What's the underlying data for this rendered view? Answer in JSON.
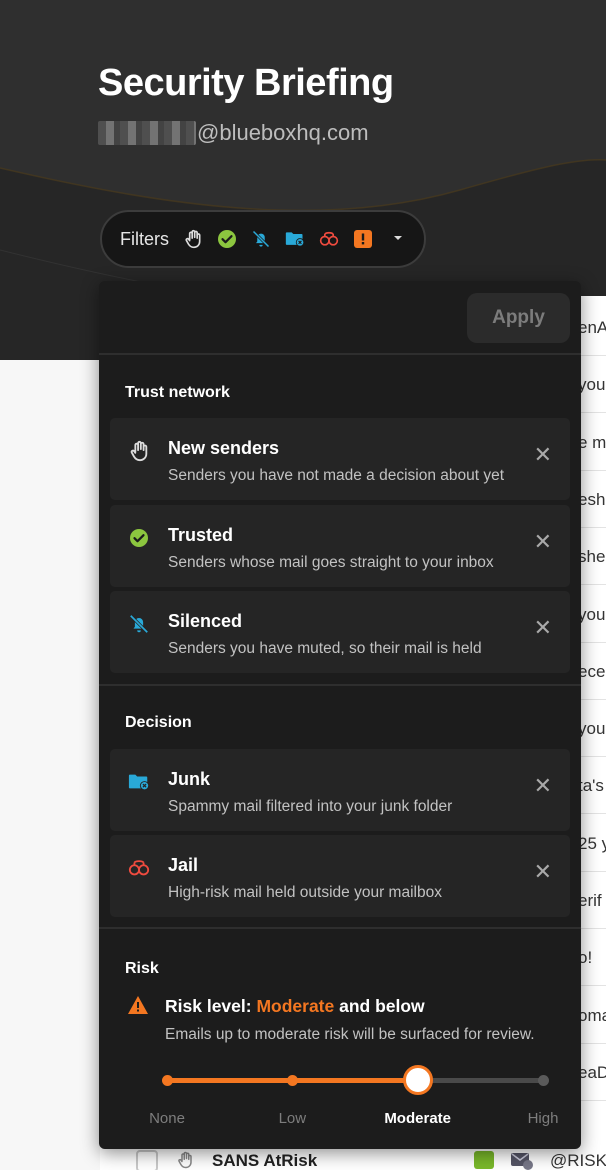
{
  "header": {
    "title": "Security Briefing",
    "email_domain": "@blueboxhq.com"
  },
  "filters": {
    "label": "Filters",
    "chips": [
      "wave-hand-icon",
      "check-circle-icon",
      "bell-off-icon",
      "folder-x-icon",
      "handcuffs-icon",
      "alert-square-icon"
    ]
  },
  "dropdown": {
    "apply_label": "Apply",
    "sections": {
      "trust": {
        "title": "Trust network",
        "items": [
          {
            "title": "New senders",
            "desc": "Senders you have not made a decision about yet",
            "icon": "wave-hand-icon"
          },
          {
            "title": "Trusted",
            "desc": "Senders whose mail goes straight to your inbox",
            "icon": "check-circle-icon"
          },
          {
            "title": "Silenced",
            "desc": "Senders you have muted, so their mail is held",
            "icon": "bell-off-icon"
          }
        ]
      },
      "decision": {
        "title": "Decision",
        "items": [
          {
            "title": "Junk",
            "desc": "Spammy mail filtered into your junk folder",
            "icon": "folder-x-icon"
          },
          {
            "title": "Jail",
            "desc": "High-risk mail held outside your mailbox",
            "icon": "handcuffs-icon"
          }
        ]
      },
      "risk": {
        "title": "Risk",
        "heading_prefix": "Risk level: ",
        "level": "Moderate",
        "heading_suffix": " and below",
        "desc": "Emails up to moderate risk will be surfaced for review.",
        "stops": [
          "None",
          "Low",
          "Moderate",
          "High"
        ],
        "selected_index": 2
      }
    }
  },
  "background_list": {
    "peek_texts": [
      "enA",
      "you",
      "e mo",
      "esh",
      "she",
      "you",
      "ece",
      "you",
      "ta's",
      "25 y",
      "erif",
      "o!",
      "oma",
      "eaD"
    ],
    "bottom_row": {
      "sender": "SANS AtRisk",
      "handle": "@RISK"
    }
  },
  "colors": {
    "accent": "#f47721",
    "trusted": "#8cc63f",
    "junk": "#29a9d8",
    "jail": "#ef4b3f",
    "panel": "#1c1c1c"
  }
}
